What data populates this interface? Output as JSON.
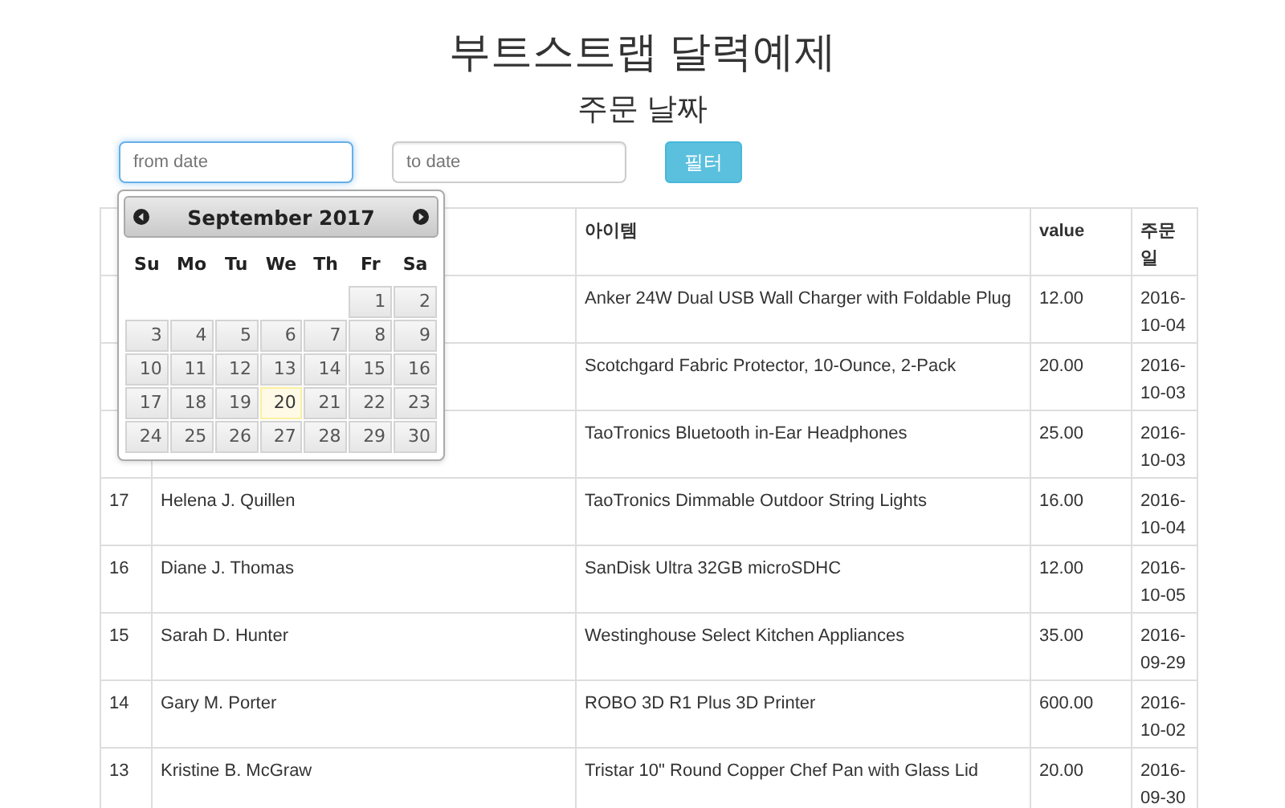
{
  "title": "부트스트랩 달력예제",
  "subtitle": "주문 날짜",
  "filters": {
    "from": {
      "placeholder": "from date",
      "focused": true
    },
    "to": {
      "placeholder": "to date",
      "focused": false
    },
    "button": "필터"
  },
  "table": {
    "columns": [
      "아이템",
      "value",
      "주문일"
    ],
    "rows": [
      {
        "item": "Anker 24W Dual USB Wall Charger with Foldable Plug",
        "value": "12.00",
        "date": "2016-10-04"
      },
      {
        "item": "Scotchgard Fabric Protector, 10-Ounce, 2-Pack",
        "value": "20.00",
        "date": "2016-10-03"
      },
      {
        "item": "TaoTronics Bluetooth in-Ear Headphones",
        "value": "25.00",
        "date": "2016-10-03"
      },
      {
        "no": "17",
        "name": "Helena J. Quillen",
        "item": "TaoTronics Dimmable Outdoor String Lights",
        "value": "16.00",
        "date": "2016-10-04"
      },
      {
        "no": "16",
        "name": "Diane J. Thomas",
        "item": "SanDisk Ultra 32GB microSDHC",
        "value": "12.00",
        "date": "2016-10-05"
      },
      {
        "no": "15",
        "name": "Sarah D. Hunter",
        "item": "Westinghouse Select Kitchen Appliances",
        "value": "35.00",
        "date": "2016-09-29"
      },
      {
        "no": "14",
        "name": "Gary M. Porter",
        "item": "ROBO 3D R1 Plus 3D Printer",
        "value": "600.00",
        "date": "2016-10-02"
      },
      {
        "no": "13",
        "name": "Kristine B. McGraw",
        "item": "Tristar 10\" Round Copper Chef Pan with Glass Lid",
        "value": "20.00",
        "date": "2016-09-30"
      }
    ]
  },
  "calendar": {
    "month": "September 2017",
    "weekdays": [
      "Su",
      "Mo",
      "Tu",
      "We",
      "Th",
      "Fr",
      "Sa"
    ],
    "weeks": [
      {
        "days": [
          {
            "day": "1",
            "today": false
          },
          {
            "day": "2",
            "today": false
          }
        ]
      },
      {
        "days": [
          {
            "day": "3",
            "today": false
          },
          {
            "day": "4",
            "today": false
          },
          {
            "day": "5",
            "today": false
          },
          {
            "day": "6",
            "today": false
          },
          {
            "day": "7",
            "today": false
          },
          {
            "day": "8",
            "today": false
          },
          {
            "day": "9",
            "today": false
          }
        ]
      },
      {
        "days": [
          {
            "day": "10",
            "today": false
          },
          {
            "day": "11",
            "today": false
          },
          {
            "day": "12",
            "today": false
          },
          {
            "day": "13",
            "today": false
          },
          {
            "day": "14",
            "today": false
          },
          {
            "day": "15",
            "today": false
          },
          {
            "day": "16",
            "today": false
          }
        ]
      },
      {
        "days": [
          {
            "day": "17",
            "today": false
          },
          {
            "day": "18",
            "today": false
          },
          {
            "day": "19",
            "today": false
          },
          {
            "day": "20",
            "today": true
          },
          {
            "day": "21",
            "today": false
          },
          {
            "day": "22",
            "today": false
          },
          {
            "day": "23",
            "today": false
          }
        ]
      },
      {
        "days": [
          {
            "day": "24",
            "today": false
          },
          {
            "day": "25",
            "today": false
          },
          {
            "day": "26",
            "today": false
          },
          {
            "day": "27",
            "today": false
          },
          {
            "day": "28",
            "today": false
          },
          {
            "day": "29",
            "today": false
          },
          {
            "day": "30",
            "today": false
          }
        ]
      }
    ]
  }
}
